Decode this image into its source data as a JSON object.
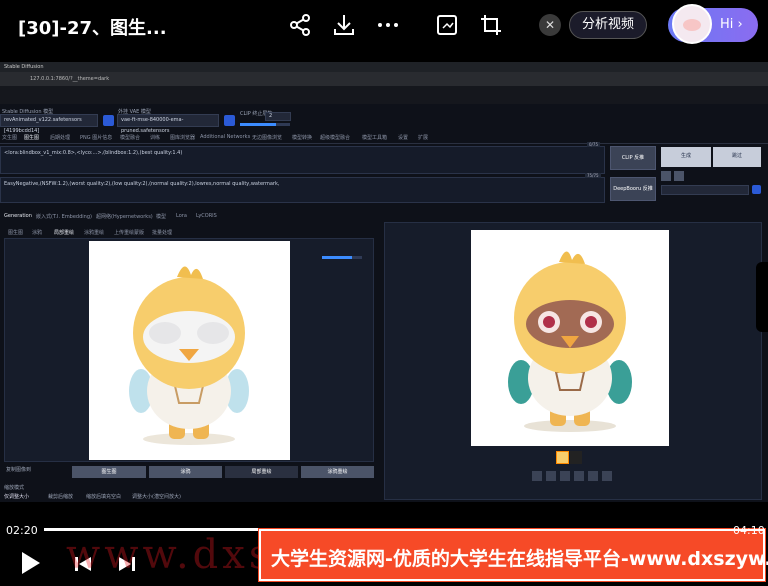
{
  "player": {
    "title": "[30]-27、图生...",
    "analyze_label": "分析视频",
    "hi_label": "Hi ›",
    "current_time": "02:20",
    "end_time": "04:10",
    "progress_fraction": 0.3,
    "icons": [
      "share-icon",
      "download-icon",
      "more-icon",
      "screen-capture-icon",
      "crop-icon",
      "close-icon",
      "play-icon",
      "previous-icon",
      "next-icon"
    ]
  },
  "browser": {
    "tab_title": "Stable Diffusion",
    "url": "127.0.0.1:7860/?__theme=dark"
  },
  "webui": {
    "checkpoint_label": "Stable Diffusion 模型",
    "checkpoint_value": "revAnimated_v122.safetensors [4199bcdd14]",
    "vae_label": "外挂 VAE 模型",
    "vae_value": "vae-ft-mse-840000-ema-pruned.safetensors",
    "clip_label": "CLIP 终止层数",
    "clip_value": "2",
    "tabs": [
      "文生图",
      "图生图",
      "后期处理",
      "PNG 图片信息",
      "模型融合",
      "训练",
      "图库浏览器",
      "Additional Networks",
      "无边图像浏览",
      "模型转换",
      "超级模型融合",
      "模型工具箱",
      "设置",
      "扩展"
    ],
    "positive_prompt": "<lora:blindbox_v1_mix:0.8>,<lyco:...>,(blindbox:1.2),(best quality:1.4)",
    "negative_prompt": "EasyNegative,(NSFW:1.2),(worst quality:2),(low quality:2),(normal quality:2),lowres,normal quality,watermark,",
    "positive_counter": "0/75",
    "negative_counter": "75/75",
    "interrogate_clip": "CLIP 反推",
    "interrogate_deepbooru": "DeepBooru 反推",
    "generate_label": "生成",
    "stop_label": "跳过",
    "sub_tabs": [
      "Generation",
      "嵌入式(T.I. Embedding)",
      "超网络(Hypernetworks)",
      "模型",
      "Lora",
      "LyCORIS"
    ],
    "img_tabs": [
      "图生图",
      "涂鸦",
      "局部重绘",
      "涂鸦重绘",
      "上传重绘蒙版",
      "批量处理"
    ],
    "copy_label": "复制图像到",
    "action_buttons": [
      "图生图",
      "涂鸦",
      "局部重绘",
      "涂鸦重绘"
    ],
    "resize_label": "缩放模式",
    "resize_options": [
      "仅调整大小",
      "裁剪后缩放",
      "缩放后填充空白",
      "调整大小(潜空间放大)"
    ]
  },
  "banner": {
    "text": "大学生资源网-优质的大学生在线指导平台-www.dxszyw.cn",
    "watermark": "www.dxs"
  }
}
